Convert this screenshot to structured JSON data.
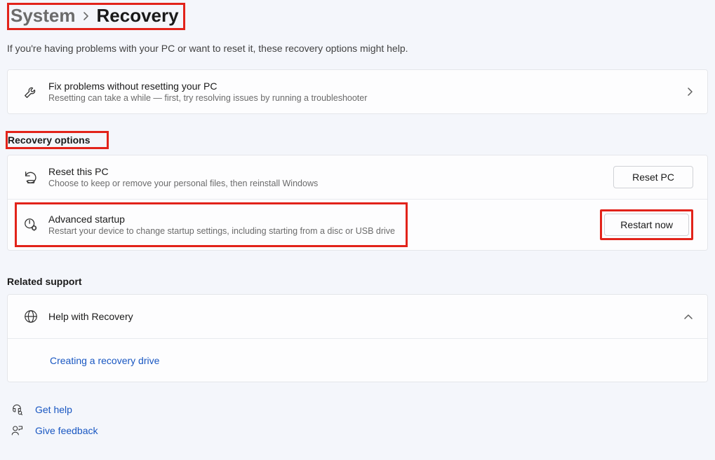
{
  "breadcrumb": {
    "parent": "System",
    "current": "Recovery"
  },
  "subtitle": "If you're having problems with your PC or want to reset it, these recovery options might help.",
  "fix": {
    "title": "Fix problems without resetting your PC",
    "desc": "Resetting can take a while — first, try resolving issues by running a troubleshooter"
  },
  "sections": {
    "recovery_heading": "Recovery options",
    "related_heading": "Related support"
  },
  "reset": {
    "title": "Reset this PC",
    "desc": "Choose to keep or remove your personal files, then reinstall Windows",
    "button": "Reset PC"
  },
  "advanced": {
    "title": "Advanced startup",
    "desc": "Restart your device to change startup settings, including starting from a disc or USB drive",
    "button": "Restart now"
  },
  "help": {
    "title": "Help with Recovery",
    "link": "Creating a recovery drive"
  },
  "footer": {
    "get_help": "Get help",
    "feedback": "Give feedback"
  }
}
